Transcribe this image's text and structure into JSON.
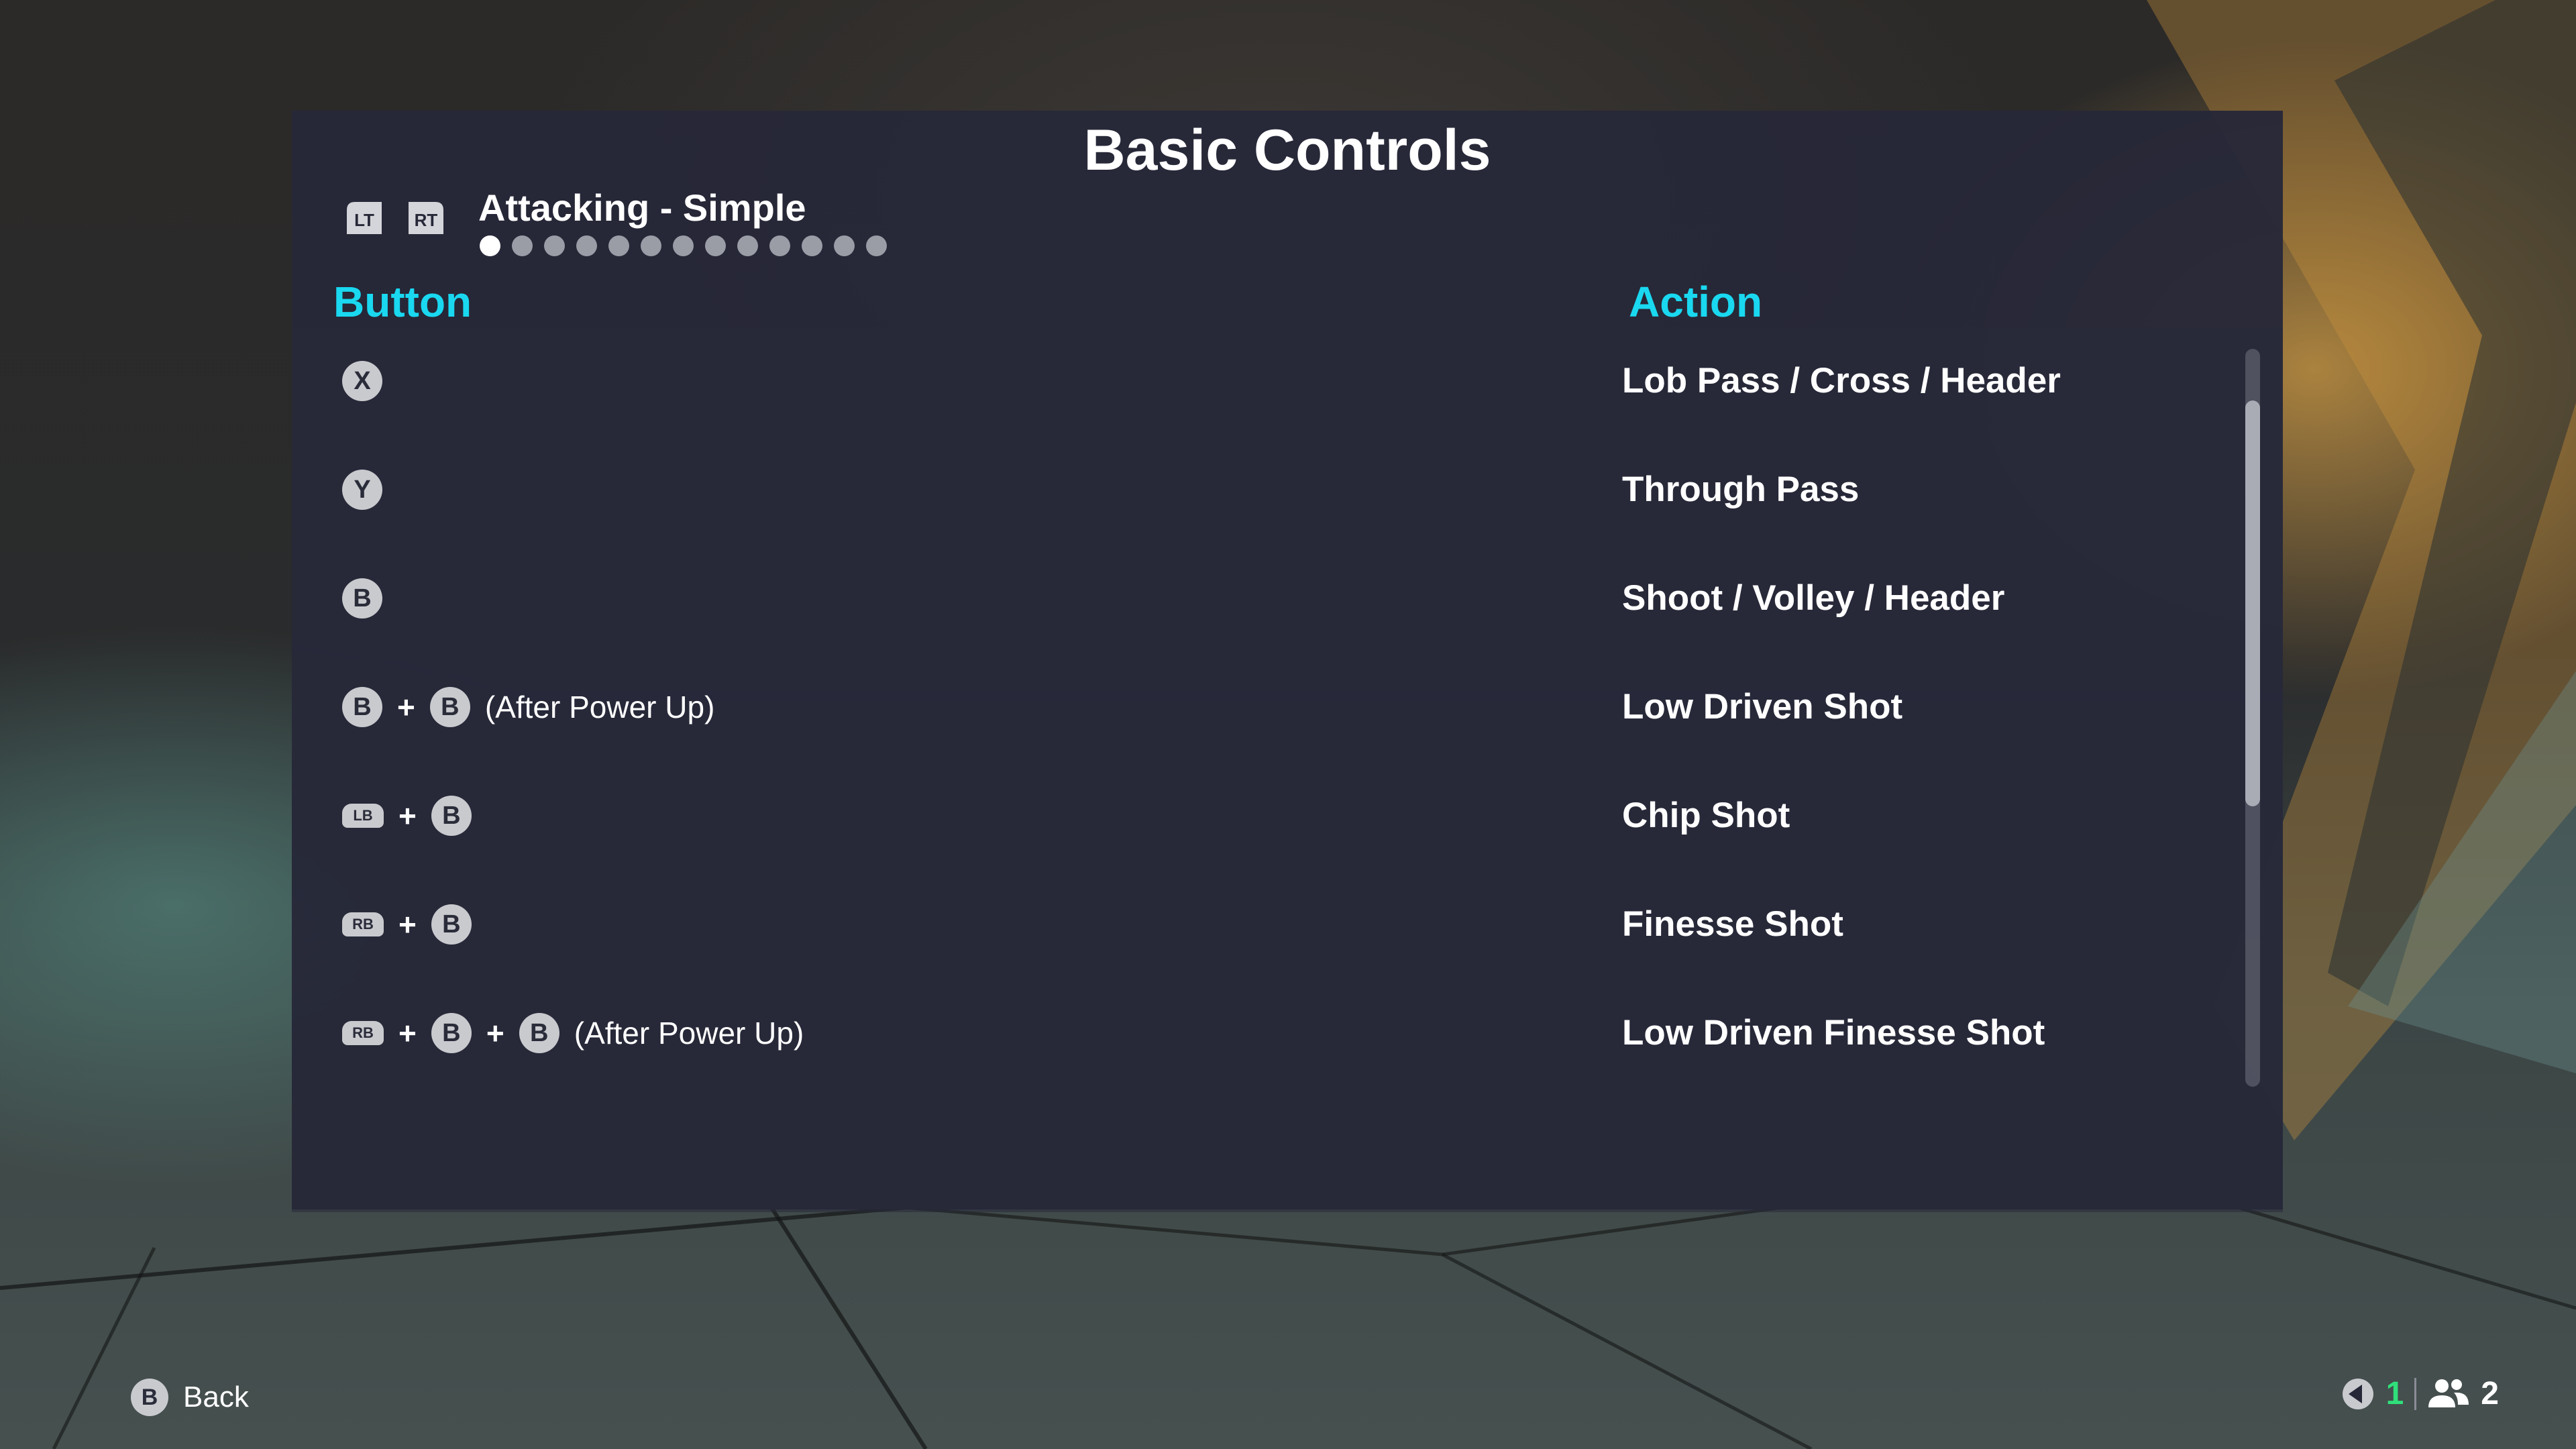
{
  "title": "Basic Controls",
  "header": {
    "left_trigger": "LT",
    "right_trigger": "RT",
    "section_name": "Attacking - Simple",
    "page_count": 13,
    "active_page": 1
  },
  "columns": {
    "button": "Button",
    "action": "Action"
  },
  "rows": [
    {
      "inputs": [
        {
          "type": "face",
          "label": "X"
        }
      ],
      "note": "",
      "action": "Lob Pass / Cross / Header"
    },
    {
      "inputs": [
        {
          "type": "face",
          "label": "Y"
        }
      ],
      "note": "",
      "action": "Through Pass"
    },
    {
      "inputs": [
        {
          "type": "face",
          "label": "B"
        }
      ],
      "note": "",
      "action": "Shoot / Volley / Header"
    },
    {
      "inputs": [
        {
          "type": "face",
          "label": "B"
        },
        {
          "type": "face",
          "label": "B"
        }
      ],
      "note": "(After Power Up)",
      "action": "Low Driven Shot"
    },
    {
      "inputs": [
        {
          "type": "bumper",
          "label": "LB"
        },
        {
          "type": "face",
          "label": "B"
        }
      ],
      "note": "",
      "action": "Chip Shot"
    },
    {
      "inputs": [
        {
          "type": "bumper",
          "label": "RB"
        },
        {
          "type": "face",
          "label": "B"
        }
      ],
      "note": "",
      "action": "Finesse Shot"
    },
    {
      "inputs": [
        {
          "type": "bumper",
          "label": "RB"
        },
        {
          "type": "face",
          "label": "B"
        },
        {
          "type": "face",
          "label": "B"
        }
      ],
      "note": "(After Power Up)",
      "action": "Low Driven Finesse Shot"
    }
  ],
  "plus_sign": "+",
  "scroll": {
    "visible_fraction": 0.55,
    "position": 0.07
  },
  "footer": {
    "back_button": "B",
    "back_label": "Back",
    "local_count": "1",
    "online_count": "2"
  },
  "colors": {
    "accent": "#19d8f0",
    "green": "#2fe07a",
    "panel": "#262838"
  }
}
